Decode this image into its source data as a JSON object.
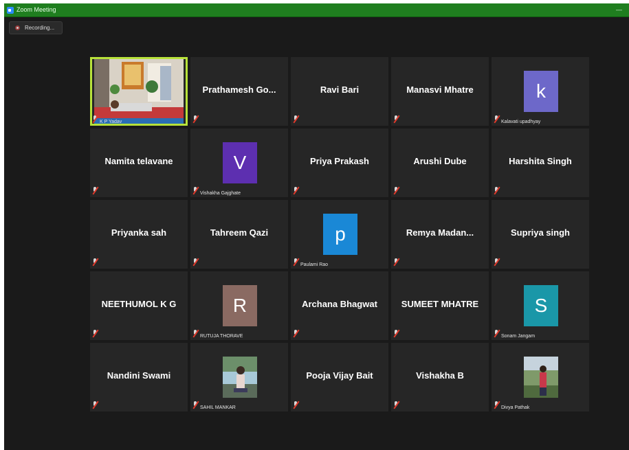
{
  "window": {
    "title": "Zoom Meeting",
    "minimize": "—"
  },
  "recording": {
    "label": "Recording..."
  },
  "tiles": [
    {
      "kind": "video",
      "label": "K P Yadav"
    },
    {
      "kind": "name",
      "name": "Prathamesh  Go..."
    },
    {
      "kind": "name",
      "name": "Ravi Bari"
    },
    {
      "kind": "name",
      "name": "Manasvi Mhatre"
    },
    {
      "kind": "avatar",
      "letter": "k",
      "color": "#6d68c9",
      "label": "Kalavati upadhyay"
    },
    {
      "kind": "name",
      "name": "Namita telavane"
    },
    {
      "kind": "avatar",
      "letter": "V",
      "color": "#5d2fb0",
      "label": "Vishakha Gajghate"
    },
    {
      "kind": "name",
      "name": "Priya Prakash"
    },
    {
      "kind": "name",
      "name": "Arushi Dube"
    },
    {
      "kind": "name",
      "name": "Harshita Singh"
    },
    {
      "kind": "name",
      "name": "Priyanka sah"
    },
    {
      "kind": "name",
      "name": "Tahreem Qazi"
    },
    {
      "kind": "avatar",
      "letter": "p",
      "color": "#1a88d6",
      "label": "Paulami Rao"
    },
    {
      "kind": "name",
      "name": "Remya  Madan..."
    },
    {
      "kind": "name",
      "name": "Supriya singh"
    },
    {
      "kind": "name",
      "name": "NEETHUMOL K G"
    },
    {
      "kind": "avatar",
      "letter": "R",
      "color": "#8a6a62",
      "label": "RUTUJA THORAVE"
    },
    {
      "kind": "name",
      "name": "Archana Bhagwat"
    },
    {
      "kind": "name",
      "name": "SUMEET MHATRE"
    },
    {
      "kind": "avatar",
      "letter": "S",
      "color": "#1a97a8",
      "label": "Sonam Jangam"
    },
    {
      "kind": "name",
      "name": "Nandini Swami"
    },
    {
      "kind": "photo",
      "label": "SAHIL MANKAR",
      "photo": "person-outdoor"
    },
    {
      "kind": "name",
      "name": "Pooja Vijay Bait"
    },
    {
      "kind": "name",
      "name": "Vishakha B"
    },
    {
      "kind": "photo",
      "label": "Divya Pathak",
      "photo": "person-hill"
    }
  ]
}
